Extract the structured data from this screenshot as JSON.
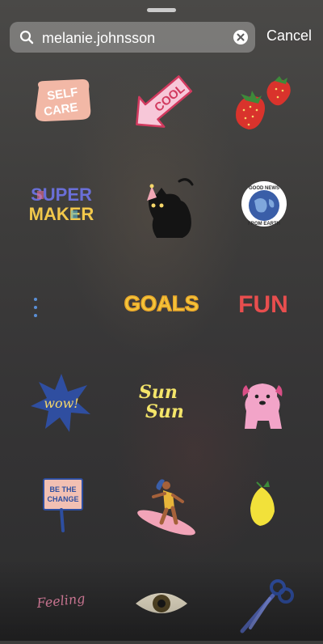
{
  "search": {
    "query": "melanie.johnsson",
    "placeholder": "Search"
  },
  "cancel_label": "Cancel",
  "stickers": [
    {
      "name": "self-care",
      "text_lines": [
        "SELF",
        "CARE"
      ]
    },
    {
      "name": "cool-arrow",
      "text": "COOL"
    },
    {
      "name": "strawberries"
    },
    {
      "name": "super-maker",
      "text_lines": [
        "SUPER",
        "MAKER"
      ]
    },
    {
      "name": "black-cat"
    },
    {
      "name": "good-news-earth",
      "text_top": "GOOD NEWS",
      "text_bottom": "FROM EARTH"
    },
    {
      "name": "dots"
    },
    {
      "name": "goals",
      "text": "GOALS"
    },
    {
      "name": "fun",
      "text": "FUN"
    },
    {
      "name": "wow-star",
      "text": "wow!"
    },
    {
      "name": "sun-sun",
      "text_lines": [
        "Sun",
        "Sun"
      ]
    },
    {
      "name": "pink-pug"
    },
    {
      "name": "be-the-change-sign",
      "text_lines": [
        "BE THE",
        "CHANGE"
      ]
    },
    {
      "name": "surfer"
    },
    {
      "name": "lemon"
    },
    {
      "name": "feeling",
      "text": "Feeling"
    },
    {
      "name": "eye"
    },
    {
      "name": "scissors"
    }
  ]
}
